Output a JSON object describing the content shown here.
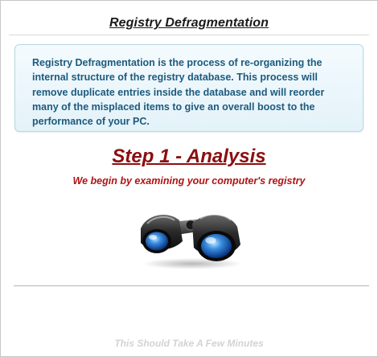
{
  "header": {
    "title": "Registry Defragmentation"
  },
  "info_box": {
    "text": "Registry Defragmentation is the process of re-organizing the internal structure of the registry database. This process will remove duplicate entries inside the database and will reorder many of the misplaced items to give an overall boost to the performance of your PC."
  },
  "step": {
    "title": "Step 1 - Analysis",
    "subtitle": "We begin by examining your computer's registry"
  },
  "illustration": {
    "icon": "binoculars-icon"
  },
  "footer": {
    "note": "This Should Take A Few Minutes"
  },
  "colors": {
    "info_text": "#1d5a7d",
    "step_title": "#8b0e10",
    "step_subtitle": "#b01214",
    "footer_note": "#d3d3d3"
  }
}
